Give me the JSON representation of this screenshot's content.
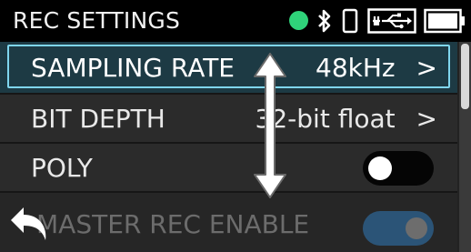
{
  "header": {
    "title": "REC SETTINGS",
    "status_color": "#2fd37a",
    "icons": [
      "bluetooth-icon",
      "phone-icon",
      "usb-power-icon",
      "battery-icon"
    ]
  },
  "settings": [
    {
      "label": "SAMPLING RATE",
      "value": "48kHz",
      "chevron": ">",
      "selected": true
    },
    {
      "label": "BIT DEPTH",
      "value": "32-bit float",
      "chevron": ">"
    },
    {
      "label": "POLY",
      "toggle": "off"
    },
    {
      "label": "MASTER REC ENABLE",
      "toggle": "on"
    }
  ],
  "overlays": {
    "back": "back-arrow-icon",
    "scroll_hint": "vertical-scroll-arrow-icon"
  },
  "colors": {
    "selection_border": "#7fd6ee",
    "selection_bg": "#1d3a44",
    "toggle_on": "#2d5d86"
  }
}
